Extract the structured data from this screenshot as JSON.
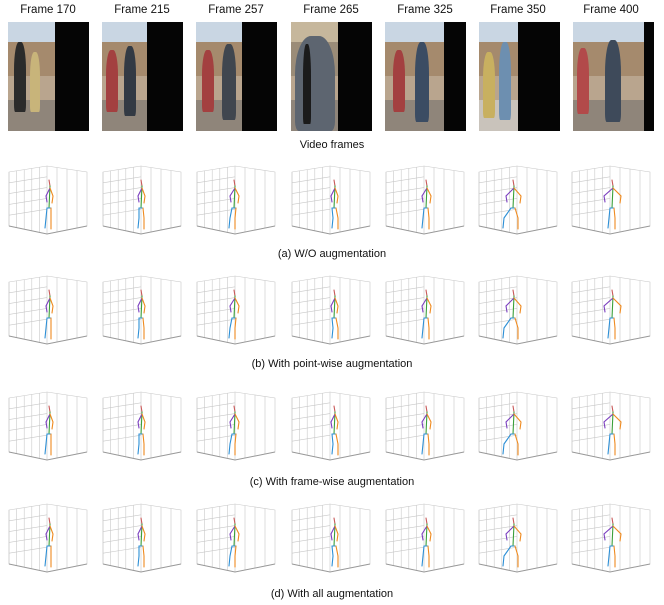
{
  "frames": [
    {
      "title": "Frame 170"
    },
    {
      "title": "Frame 215"
    },
    {
      "title": "Frame 257"
    },
    {
      "title": "Frame 265"
    },
    {
      "title": "Frame 325"
    },
    {
      "title": "Frame 350"
    },
    {
      "title": "Frame 400"
    }
  ],
  "captions": {
    "video_frames": "Video frames",
    "row_a": "(a) W/O augmentation",
    "row_b": "(b) With point-wise augmentation",
    "row_c": "(c) With frame-wise augmentation",
    "row_d": "(d) With all augmentation"
  },
  "colors": {
    "spine": "#3a9f3a",
    "left_limb": "#7b3fbf",
    "right_limb": "#ef8a1f",
    "torso": "#2c8fd6",
    "head": "#c95a5a",
    "grid": "#c8c8c8"
  }
}
